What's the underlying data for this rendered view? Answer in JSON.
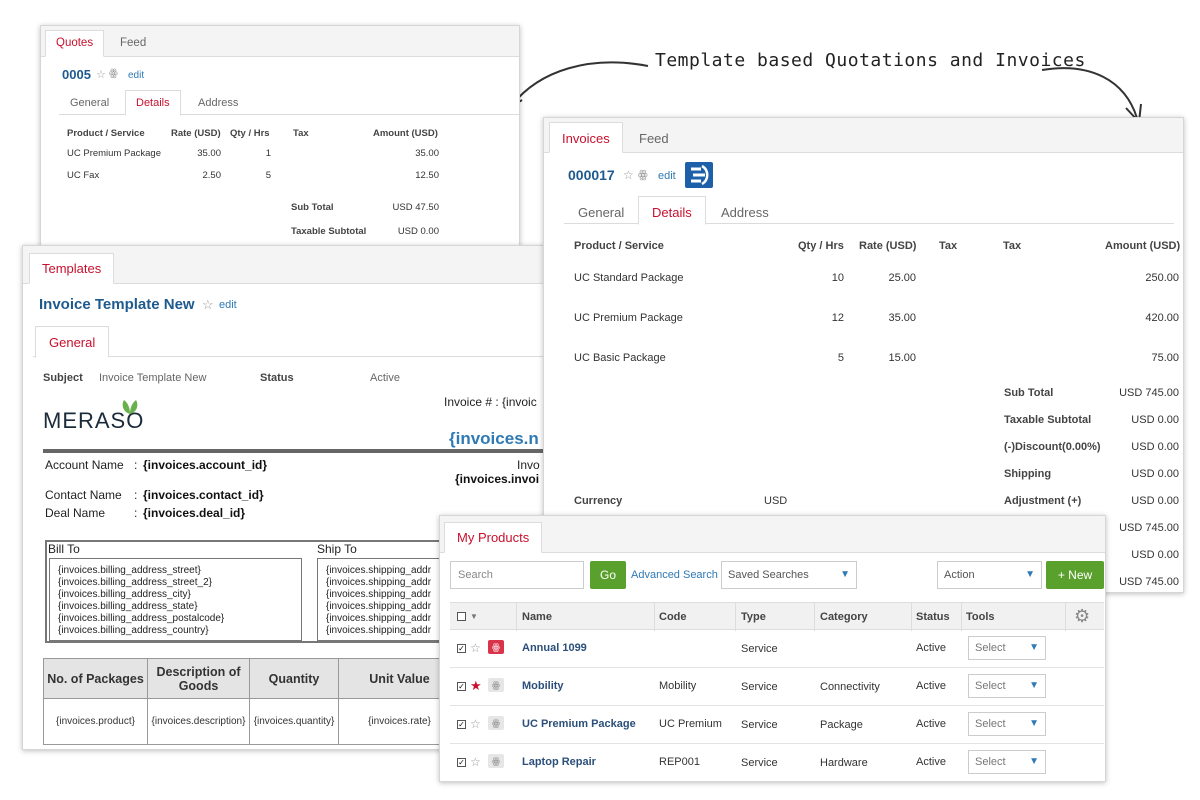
{
  "callout": "Template based Quotations and Invoices",
  "quotes": {
    "tabs": [
      "Quotes",
      "Feed"
    ],
    "number": "0005",
    "edit": "edit",
    "subtabs": [
      "General",
      "Details",
      "Address"
    ],
    "columns": [
      "Product / Service",
      "Rate (USD)",
      "Qty / Hrs",
      "Tax",
      "Amount (USD)"
    ],
    "rows": [
      {
        "product": "UC Premium Package",
        "rate": "35.00",
        "qty": "1",
        "amount": "35.00"
      },
      {
        "product": "UC Fax",
        "rate": "2.50",
        "qty": "5",
        "amount": "12.50"
      }
    ],
    "totals": [
      {
        "label": "Sub Total",
        "value": "USD 47.50"
      },
      {
        "label": "Taxable Subtotal",
        "value": "USD 0.00"
      }
    ]
  },
  "templates": {
    "tab": "Templates",
    "title": "Invoice Template New",
    "edit": "edit",
    "subtab": "General",
    "subject_label": "Subject",
    "subject_value": "Invoice Template New",
    "status_label": "Status",
    "status_value": "Active",
    "logo": "MERASO",
    "invoice_no": "Invoice # : {invoic",
    "invoice_big": "{invoices.n",
    "invo_label": "Invo",
    "invo_value": "{invoices.invoi",
    "account_label": "Account Name",
    "account_value": "{invoices.account_id}",
    "contact_label": "Contact Name",
    "contact_value": "{invoices.contact_id}",
    "deal_label": "Deal Name",
    "deal_value": "{invoices.deal_id}",
    "colon": ":",
    "bill_to": "Bill To",
    "ship_to": "Ship To",
    "bill_lines": [
      "{invoices.billing_address_street}",
      "{invoices.billing_address_street_2}",
      "{invoices.billing_address_city}",
      "{invoices.billing_address_state}",
      "{invoices.billing_address_postalcode}",
      "{invoices.billing_address_country}"
    ],
    "ship_lines": [
      "{invoices.shipping_addr",
      "{invoices.shipping_addr",
      "{invoices.shipping_addr",
      "{invoices.shipping_addr",
      "{invoices.shipping_addr",
      "{invoices.shipping_addr"
    ],
    "goods_headers": [
      "No. of Packages",
      "Description of Goods",
      "Quantity",
      "Unit Value"
    ],
    "goods_row": [
      "{invoices.product}",
      "{invoices.description}",
      "{invoices.quantity}",
      "{invoices.rate}"
    ]
  },
  "invoices": {
    "tabs": [
      "Invoices",
      "Feed"
    ],
    "number": "000017",
    "edit": "edit",
    "subtabs": [
      "General",
      "Details",
      "Address"
    ],
    "columns": [
      "Product / Service",
      "Qty / Hrs",
      "Rate (USD)",
      "Tax",
      "Tax",
      "Amount (USD)"
    ],
    "rows": [
      {
        "product": "UC Standard Package",
        "qty": "10",
        "rate": "25.00",
        "amount": "250.00"
      },
      {
        "product": "UC Premium Package",
        "qty": "12",
        "rate": "35.00",
        "amount": "420.00"
      },
      {
        "product": "UC Basic Package",
        "qty": "5",
        "rate": "15.00",
        "amount": "75.00"
      }
    ],
    "totals": [
      {
        "label": "Sub Total",
        "value": "USD 745.00"
      },
      {
        "label": "Taxable Subtotal",
        "value": "USD 0.00"
      },
      {
        "label": "(-)Discount(0.00%)",
        "value": "USD 0.00"
      },
      {
        "label": "Shipping",
        "value": "USD 0.00"
      },
      {
        "label": "Adjustment (+)",
        "value": "USD 0.00"
      }
    ],
    "extra_values": [
      "USD 745.00",
      "USD 0.00",
      "USD 745.00"
    ],
    "currency_label": "Currency",
    "currency_value": "USD"
  },
  "products": {
    "tab": "My Products",
    "search_placeholder": "Search",
    "go": "Go",
    "advanced_search": "Advanced Search",
    "saved_searches": "Saved Searches",
    "action": "Action",
    "new": "+ New",
    "columns": [
      "Name",
      "Code",
      "Type",
      "Category",
      "Status",
      "Tools"
    ],
    "rows": [
      {
        "name": "Annual 1099",
        "code": "",
        "type": "Service",
        "category": "",
        "status": "Active",
        "tools": "Select",
        "starred": false
      },
      {
        "name": "Mobility",
        "code": "Mobility",
        "type": "Service",
        "category": "Connectivity",
        "status": "Active",
        "tools": "Select",
        "starred": true
      },
      {
        "name": "UC Premium Package",
        "code": "UC Premium",
        "type": "Service",
        "category": "Package",
        "status": "Active",
        "tools": "Select",
        "starred": false
      },
      {
        "name": "Laptop Repair",
        "code": "REP001",
        "type": "Service",
        "category": "Hardware",
        "status": "Active",
        "tools": "Select",
        "starred": false
      }
    ],
    "colors": {
      "go": "#5aa02c",
      "star_on": "#c8102e",
      "link": "#2b4f7a"
    }
  }
}
